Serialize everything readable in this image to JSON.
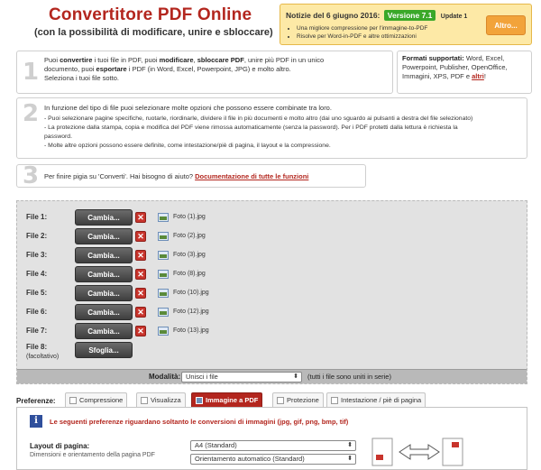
{
  "header": {
    "title": "Convertitore PDF Online",
    "subtitle": "(con la possibilità di modificare, unire e sbloccare)"
  },
  "news": {
    "heading": "Notizie del 6 giugno 2016:",
    "version": "Versione 7.1",
    "update": "Update 1",
    "items": [
      "Una migliore compressione per l'immagine-to-PDF",
      "Risolve per Word-in-PDF e altre ottimizzazioni"
    ],
    "more_button": "Altro..."
  },
  "steps": {
    "one": {
      "num": "1",
      "t1": "Puoi ",
      "b1": "convertire",
      "t2": " i tuoi file in PDF, puoi ",
      "b2": "modificare",
      "t3": ", ",
      "b3": "sbloccare PDF",
      "t4": ", unire più PDF in un unico",
      "line2a": "documento, puoi ",
      "b4": "esportare",
      "line2b": " i PDF (in Word, Excel, Powerpoint, JPG) e molto altro.",
      "line3": "Seleziona i tuoi file sotto."
    },
    "formats": {
      "label": "Formati supportati:",
      "list": " Word, Excel, Powerpoint, Publisher, OpenOffice, Immagini, XPS, PDF e ",
      "link": "altri",
      "end": "!"
    },
    "two": {
      "num": "2",
      "intro": "In funzione del tipo di file puoi selezionare molte opzioni che possono essere combinate tra loro.",
      "l1": "- Puoi selezionare pagine specifiche, ruotarle, riordinarle, dividere il file in più documenti e molto altro (dai uno sguardo ai pulsanti a destra del file selezionato)",
      "l2": "- La protezione dalla stampa, copia e modifica del PDF viene rimossa automaticamente (senza la password). Per i PDF protetti dalla lettura è richiesta la",
      "l2b": "password.",
      "l3": "- Molte altre opzioni possono essere definite, come intestazione/piè di pagina, il layout e la compressione."
    },
    "three": {
      "num": "3",
      "text": "Per finire pigia su 'Converti'. Hai bisogno di aiuto? ",
      "link": "Documentazione di tutte le funzioni"
    }
  },
  "files": {
    "change_label": "Cambia...",
    "browse_label": "Sfoglia...",
    "delete_glyph": "✕",
    "rows": [
      {
        "label": "File 1:",
        "name": "Foto (1).jpg"
      },
      {
        "label": "File 2:",
        "name": "Foto (2).jpg"
      },
      {
        "label": "File 3:",
        "name": "Foto (3).jpg"
      },
      {
        "label": "File 4:",
        "name": "Foto (8).jpg"
      },
      {
        "label": "File 5:",
        "name": "Foto (10).jpg"
      },
      {
        "label": "File 6:",
        "name": "Foto (12).jpg"
      },
      {
        "label": "File 7:",
        "name": "Foto (13).jpg"
      }
    ],
    "last": {
      "label": "File 8:",
      "optional": "(facoltativo)"
    }
  },
  "mode": {
    "label": "Modalità:",
    "value": "Unisci i file",
    "hint": "(tutti i file sono uniti in serie)"
  },
  "preferences": {
    "label": "Preferenze:",
    "tabs": [
      "Compressione",
      "Visualizza",
      "Immagine a PDF",
      "Protezione",
      "Intestazione / piè di pagina"
    ],
    "note": "Le seguenti preferenze riguardano soltanto le conversioni di immagini (jpg, gif, png, bmp, tif)",
    "layout_label": "Layout di pagina:",
    "layout_desc": "Dimensioni e orientamento della pagina PDF",
    "page_size": "A4 (Standard)",
    "orientation": "Orientamento automatico (Standard)"
  },
  "icons": {
    "info": "info-icon",
    "image": "image-file-icon",
    "delete": "delete-icon",
    "dropdown": "chevron-down-icon"
  },
  "colors": {
    "brand_red": "#b3261e",
    "news_bg": "#fde9a6",
    "version_green": "#3aa829",
    "button_orange": "#f2a33a"
  }
}
